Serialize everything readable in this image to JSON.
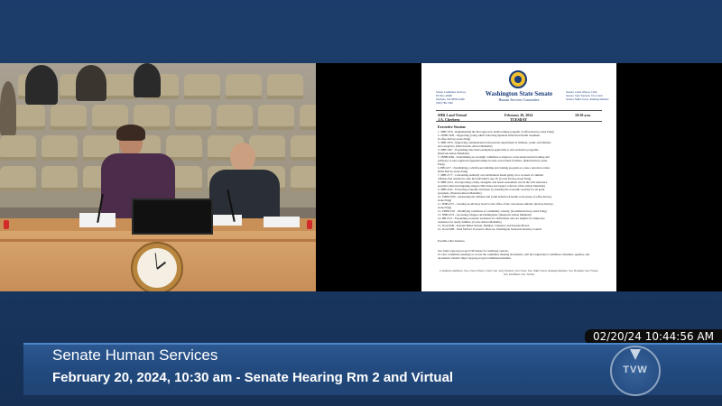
{
  "broadcast": {
    "timestamp": "02/20/24 10:44:56 AM",
    "program_title": "Senate Human Services",
    "program_subtitle": "February 20, 2024, 10:30 am - Senate Hearing Rm 2 and Virtual",
    "logo_text": "TVW"
  },
  "document": {
    "title": "Washington State Senate",
    "subtitle": "Human Services Committee",
    "left_block": [
      "Senate Committee Services",
      "PO Box 40466",
      "Olympia, WA 98504-0466",
      "(360) 786-7400"
    ],
    "right_block": [
      "Senator Claire Wilson, Chair",
      "Senator Judy Warnick, Vice Chair",
      "Senator Nikki Torres, Ranking Member"
    ],
    "meta_left": "SHR 2 and Virtual",
    "meta_left2": "J.A. Cherberg",
    "meta_center": "February 20, 2024",
    "meta_center2": "TUESDAY",
    "meta_right": "10:30 a.m.",
    "section_heading": "Executive Session:",
    "items": [
      "1. SHB 1979 - Implementing the first approved, skills training program. (Coffee-Kelvey-stone Fung)",
      "2. 2SHB 1929 - Supporting young adults following inpatient behavioral health treatment.",
      "   (Coffee-Kelvey-stone Fung)",
      "3. SHB 1870 - Improving communication between the department of children, youth, and families",
      "   and caregivers. (Mul Sawick, Alison Mandelle)",
      "4. SHB 1697 - Expanding state limit exemptions applicable to sick assistance programs.",
      "   (Petersen Alison Mandelle)",
      "5. 2SHB 2084 - Establishing an oversight committee to improve correctional-related training and",
      "   pathways to new registered apprenticeships in state correctional facilities. (Robin Kelvey-stone",
      "   Fung)",
      "6. HB 2217 - Establishing a wildfowers building and training program at a state correction center.",
      "   (Ellis Kelvey-stone Fung)",
      "7. SHB 2177 - Concerning authority over individuals found guilty of or accused of criminal",
      "   offenses that resented to take the individual's age 18. (Corrie Kelvey-stone Fung)",
      "8. SHB 2224 - Incorporating a daily, strengths, and needs assessment tool in the sick assistance",
      "   program when investigating alleged child abuse and neglect referrals. (Pele Alison Mandelle)",
      "9. SHB 2245 - Protecting economic inclusion by ensuring the economic security for all grant",
      "   programs. (Petersen Alison Mandelle)",
      "10. 2SHB 2256 - Addressing the children and youth behavioral health work group. (Coffee-Kelvey-",
      "    stone Fung)",
      "11. SHB 2257 - Creating an advisory board to the office of the corrections ombuds. (Kelvey-Kelvey-",
      "    stone Fung)",
      "12. 2SHB 2311 - Modifying conditions of community custody. (Goodman Kelvey-stone Fung)",
      "13. SHB 2272 - Accessing refugees and immigrants. (Desperdo Alison Mandelle)",
      "14. HB 1917 - Expanding economic assistance for individuals who are eligible for temporary",
      "    assistance for needy families. (Corrie Alison Mandelle)",
      "15. SGA 9346 - Katelyn Ballet Nelson, Member, Clemency and Pardons Board.",
      "16. SGA 9368 - Sand McFeet, Executive Director, Washington Statewide Reentry Council"
    ],
    "other_business": "Possible other business.",
    "see_text": "See: https://app.leg.wa.gov/CSI/Senate for testimony options.",
    "see_text2": "To view committee meetings or access the committee meeting documents, visit the Legislature's committee schedules, agendas, and documents website: https://app.leg.wa.gov/committeeschedules",
    "footer": "Committee Members: Sen. Claire Wilson, Chair; Sen. Judy Warnick, Vice Chair; Sen. Nikki Torres, Ranking Member; Sen. Boehnke; Sen. Frame; Sen. Kauffman; Sen. Nobles"
  },
  "clock": {
    "hour_angle_deg": 322,
    "minute_angle_deg": 264
  },
  "colors": {
    "band": "#224a7e",
    "accent": "#4d85c9",
    "background": "#1b3a66"
  }
}
